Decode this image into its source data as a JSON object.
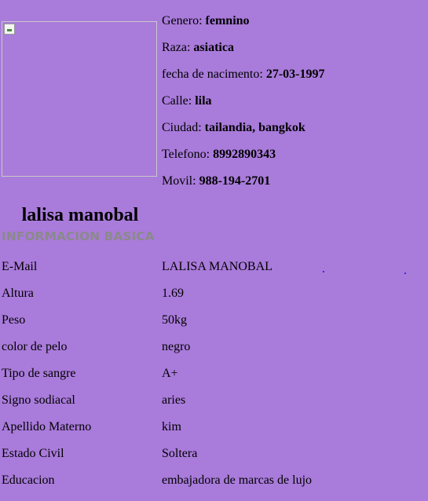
{
  "profile": {
    "photo_alt": "",
    "name": "lalisa manobal",
    "info": [
      {
        "label": "Genero: ",
        "value": "femnino"
      },
      {
        "label": "Raza: ",
        "value": "asiatica"
      },
      {
        "label": "fecha de nacimento: ",
        "value": "27-03-1997"
      },
      {
        "label": "Calle: ",
        "value": "lila"
      },
      {
        "label": "Ciudad: ",
        "value": "tailandia, bangkok"
      },
      {
        "label": "Telefono: ",
        "value": "8992890343"
      },
      {
        "label": "Movil: ",
        "value": "988-194-2701"
      }
    ]
  },
  "basic_info": {
    "title": "INFORMACION BASICA",
    "rows": [
      {
        "label": "E-Mail",
        "value": "LALISA MANOBAL"
      },
      {
        "label": "Altura",
        "value": "1.69"
      },
      {
        "label": "Peso",
        "value": "50kg"
      },
      {
        "label": "color de pelo",
        "value": "negro"
      },
      {
        "label": "Tipo de sangre",
        "value": "A+"
      },
      {
        "label": "Signo sodiacal",
        "value": "aries"
      },
      {
        "label": "Apellido Materno",
        "value": "kim"
      },
      {
        "label": "Estado Civil",
        "value": "Soltera"
      },
      {
        "label": "Educacion",
        "value": "embajadora de marcas de lujo"
      }
    ]
  },
  "colors": {
    "background": "#a97bdb",
    "section_title": "#8a8a8a"
  }
}
